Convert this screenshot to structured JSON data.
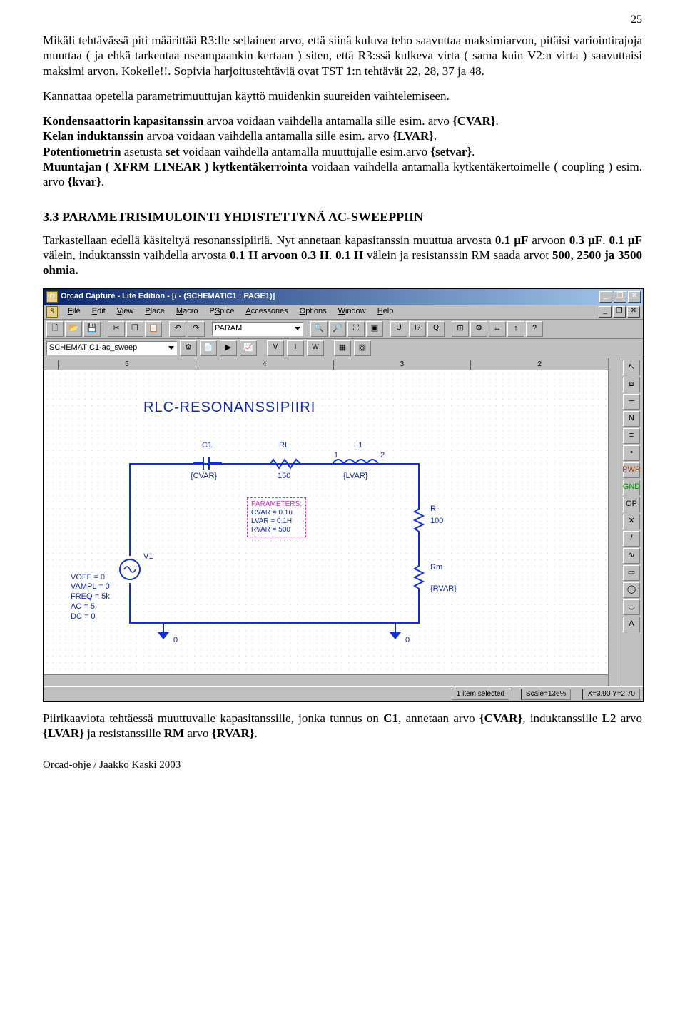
{
  "page_number": "25",
  "para1": "Mikäli tehtävässä piti määrittää R3:lle sellainen arvo, että siinä kuluva teho saavuttaa maksimiarvon, pitäisi variointirajoja muuttaa ( ja ehkä tarkentaa useampaankin kertaan ) siten, että R3:ssä kulkeva virta ( sama kuin V2:n virta ) saavuttaisi maksimi arvon. Kokeile!!.",
  "para2": "Sopivia harjoitustehtäviä ovat  TST 1:n tehtävät 22, 28, 37 ja  48.",
  "para3": "Kannattaa opetella parametrimuuttujan käyttö muidenkin suureiden vaihtelemiseen.",
  "para4_parts": {
    "a": "Kondensaattorin kapasitanssin",
    "b": "   arvoa voidaan vaihdella antamalla sille  esim. arvo ",
    "c": "{CVAR}",
    "d": ".",
    "e": "Kelan  induktanssin",
    "f": "  arvoa voidaan vaihdella antamalla sille  esim. arvo ",
    "g": "{LVAR}",
    "h": ".",
    "i": "Potentiometrin",
    "j": " asetusta ",
    "k": "set",
    "l": " voidaan vaihdella antamalla muuttujalle esim.arvo ",
    "m": "{setvar}",
    "n": ".",
    "o": "Muuntajan ( XFRM LINEAR ) kytkentäkerrointa",
    "p": " voidaan vaihdella antamalla kytkentäkertoimelle ( coupling ) esim. arvo ",
    "q": "{kvar}",
    "r": "."
  },
  "heading": "3.3 PARAMETRISIMULOINTI YHDISTETTYNÄ AC-SWEEPPIIN",
  "para5_a": "Tarkastellaan edellä käsiteltyä resonanssipiiriä. Nyt annetaan kapasitanssin muuttua arvosta ",
  "para5_b": "0.1 µF",
  "para5_c": " arvoon ",
  "para5_d": "0.3 µF",
  "para5_e": ". ",
  "para5_f": "0.1 µF",
  "para5_g": " välein, induktanssin vaihdella arvosta ",
  "para5_h": "0.1 H arvoon 0.3 H",
  "para5_i": ". ",
  "para5_j": "0.1 H",
  "para5_k": " välein  ja resistanssin RM  saada arvot ",
  "para5_l": "500, 2500 ja 3500 ohmia.",
  "app": {
    "title": "Orcad Capture - Lite Edition - [/ - (SCHEMATIC1 : PAGE1)]",
    "menu": [
      "File",
      "Edit",
      "View",
      "Place",
      "Macro",
      "PSpice",
      "Accessories",
      "Options",
      "Window",
      "Help"
    ],
    "combo_part": "PARAM",
    "session": "SCHEMATIC1-ac_sweep",
    "ruler_h": [
      "5",
      "4",
      "3",
      "2"
    ],
    "schem_title": "RLC-RESONANSSIPIIRI",
    "c1": "C1",
    "c1v": "{CVAR}",
    "rl": "RL",
    "rlv": "150",
    "l1": "L1",
    "l1v": "{LVAR}",
    "l1n1": "1",
    "l1n2": "2",
    "r": "R",
    "rv": "100",
    "rm": "Rm",
    "rmv": "{RVAR}",
    "v1": "V1",
    "v1params": [
      "VOFF = 0",
      "VAMPL = 0",
      "FREQ = 5k",
      "AC = 5",
      "DC = 0"
    ],
    "params_head": "PARAMETERS:",
    "params": [
      "CVAR = 0.1u",
      "LVAR = 0.1H",
      "RVAR = 500"
    ],
    "gnd": "0",
    "status_sel": "1 item selected",
    "status_scale": "Scale=136%",
    "status_xy": "X=3.90  Y=2.70"
  },
  "para6": "Piirikaaviota tehtäessä muuttuvalle kapasitanssille, jonka tunnus on ",
  "para6_b": "C1",
  "para6_c": ", annetaan arvo ",
  "para6_d": "{CVAR}",
  "para6_e": ", induktanssille ",
  "para6_f": "L2",
  "para6_g": " arvo ",
  "para6_h": "{LVAR}",
  "para6_i": " ja resistanssille ",
  "para6_j": "RM",
  "para6_k": " arvo ",
  "para6_l": "{RVAR}",
  "para6_m": ".",
  "footer": "Orcad-ohje / Jaakko Kaski 2003"
}
